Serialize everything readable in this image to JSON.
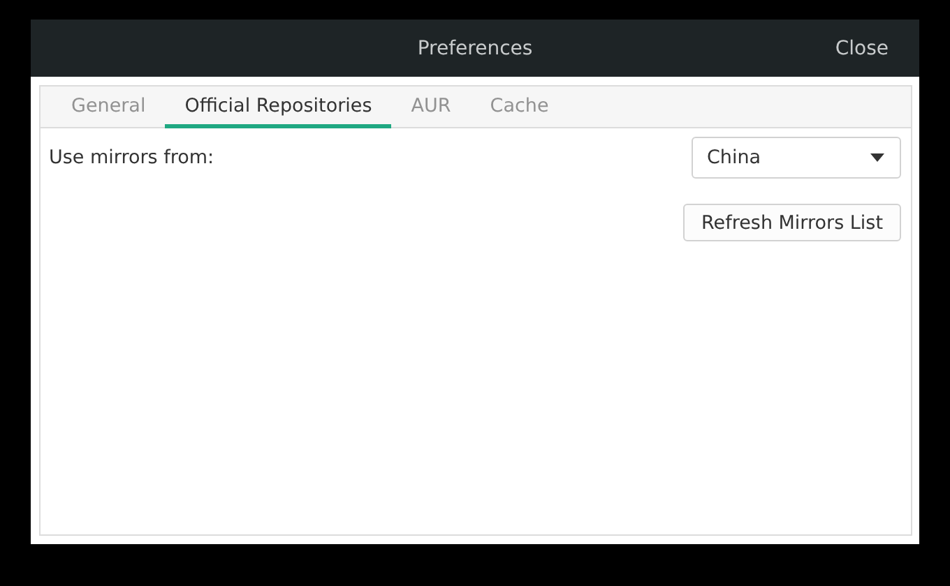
{
  "window": {
    "title": "Preferences",
    "close_label": "Close"
  },
  "tabs": [
    {
      "label": "General",
      "selected": false
    },
    {
      "label": "Official Repositories",
      "selected": true
    },
    {
      "label": "AUR",
      "selected": false
    },
    {
      "label": "Cache",
      "selected": false
    }
  ],
  "mirrors": {
    "label": "Use mirrors from:",
    "value": "China"
  },
  "buttons": [
    "Refresh Mirrors List"
  ]
}
